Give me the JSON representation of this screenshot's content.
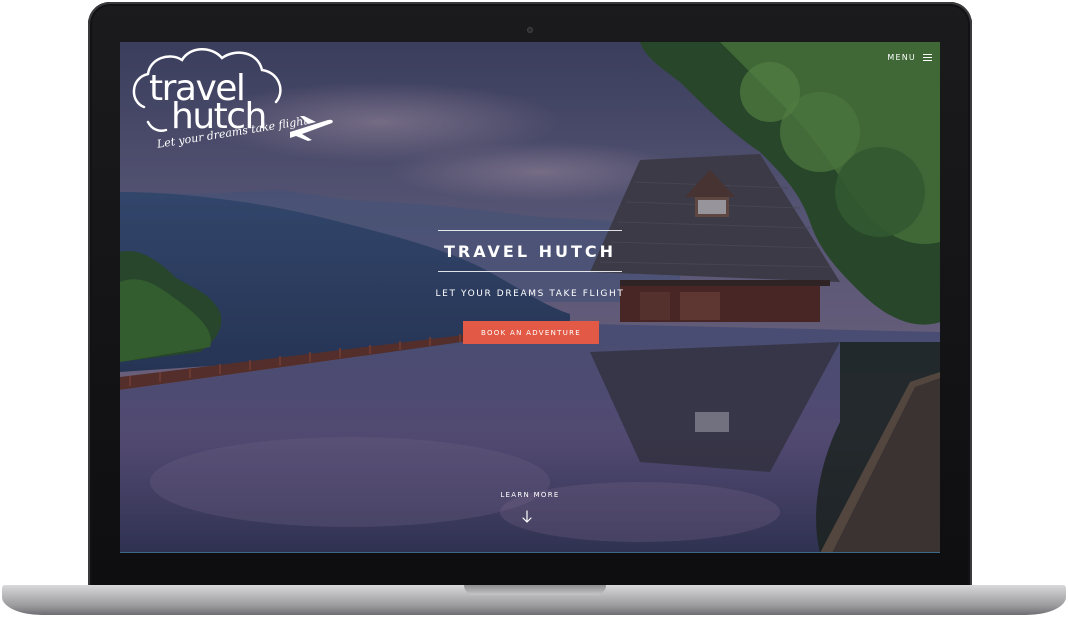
{
  "site": {
    "logo": {
      "word_top": "travel",
      "word_bottom": "hutch",
      "tagline": "Let your dreams take flight"
    },
    "menu_label": "MENU",
    "hero": {
      "title": "TRAVEL HUTCH",
      "subtitle": "LET YOUR DREAMS TAKE FLIGHT",
      "cta_label": "BOOK AN ADVENTURE"
    },
    "learn_more_label": "LEARN MORE"
  },
  "colors": {
    "accent": "#e25a45",
    "text": "#ffffff",
    "bezel": "#111113"
  },
  "icons": [
    "hamburger-menu-icon",
    "arrow-down-icon",
    "airplane-icon",
    "cloud-outline-icon"
  ]
}
